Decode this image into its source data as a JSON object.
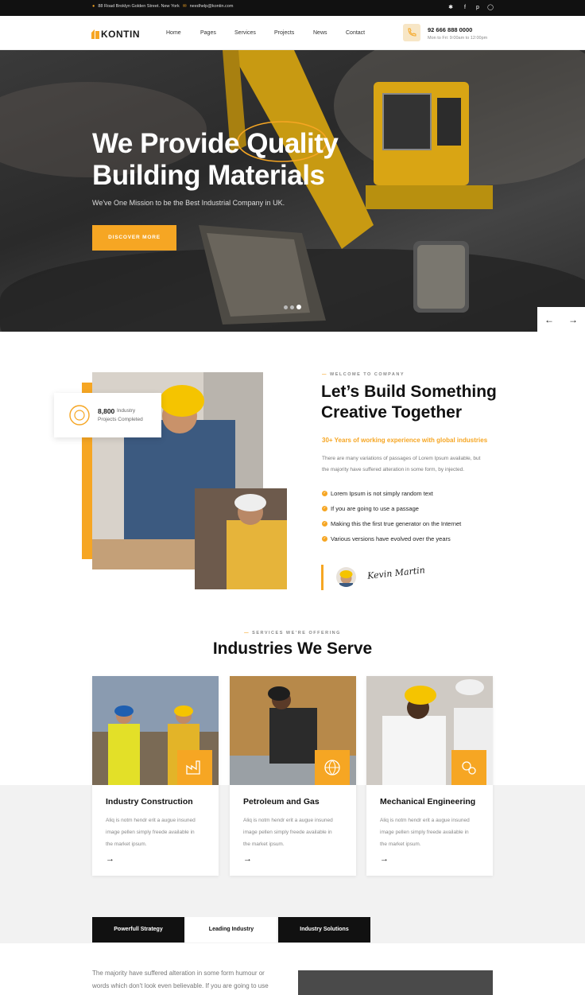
{
  "topbar": {
    "address": "88 Road Broklyn Golden Street. New York",
    "email": "needhelp@kontin.com",
    "social": [
      "twitter-icon",
      "facebook-icon",
      "pinterest-icon",
      "instagram-icon"
    ]
  },
  "nav": {
    "logo": "KONTIN",
    "links": [
      "Home",
      "Pages",
      "Services",
      "Projects",
      "News",
      "Contact"
    ],
    "phone": "92 666 888 0000",
    "hours": "Mon to Fri: 9:00am to 12:00pm"
  },
  "hero": {
    "title_line1_a": "We Provide",
    "title_line1_b": "Quality",
    "title_line2": "Building Materials",
    "subtitle": "We've One Mission to be the Best Industrial Company in UK.",
    "button": "DISCOVER MORE",
    "prev_arrow": "←",
    "next_arrow": "→"
  },
  "about": {
    "stat_number": "8,800",
    "stat_label_a": "Industry",
    "stat_label_b": "Projects Completed",
    "tag": "WELCOME TO COMPANY",
    "heading_line1": "Let’s Build Something",
    "heading_line2": "Creative Together",
    "highlight": "30+ Years of working experience with global industries",
    "paragraph_line1": "There are many variations of passages of Lorem Ipsum available, but",
    "paragraph_line2": "the majority have suffered alteration in some form, by injected.",
    "features": [
      "Lorem Ipsum is not simply random text",
      "If you are going to use a passage",
      "Making this the first true generator on the Internet",
      "Various versions have evolved over the years"
    ],
    "signature": "Kevin Martin"
  },
  "services": {
    "tag": "SERVICES WE’RE OFFERING",
    "heading": "Industries We Serve",
    "cards": [
      {
        "title": "Industry Construction",
        "l1": "Aliq is notm hendr erit a augue insuned",
        "l2": "image pellen simply freede available in",
        "l3": "the market ipsum.",
        "arrow": "→"
      },
      {
        "title": "Petroleum and Gas",
        "l1": "Aliq is notm hendr erit a augue insuned",
        "l2": "image pellen simply freede available in",
        "l3": "the market ipsum.",
        "arrow": "→"
      },
      {
        "title": "Mechanical Engineering",
        "l1": "Aliq is notm hendr erit a augue insuned",
        "l2": "image pellen simply freede available in",
        "l3": "the market ipsum.",
        "arrow": "→"
      }
    ]
  },
  "tabs": {
    "items": [
      "Powerfull Strategy",
      "Leading Industry",
      "Industry Solutions"
    ],
    "text_line1": "The majority have suffered alteration in some form humour or",
    "text_line2": "words which don't look even believable. If you are going to use"
  },
  "colors": {
    "accent": "#f6a623",
    "dark": "#111111"
  }
}
